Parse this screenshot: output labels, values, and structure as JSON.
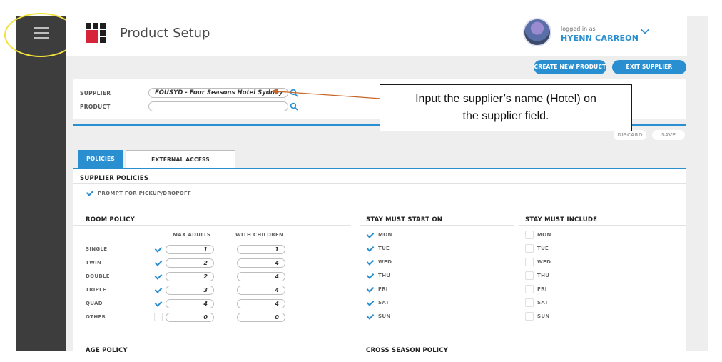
{
  "app": {
    "title": "Product Setup"
  },
  "user": {
    "logged_label": "logged in as",
    "name": "HYENN CARREON"
  },
  "actions": {
    "create_new_product": "CREATE NEW PRODUCT",
    "exit_supplier": "EXIT SUPPLIER",
    "discard": "DISCARD",
    "save": "SAVE"
  },
  "form": {
    "supplier_label": "SUPPLIER",
    "supplier_value": "FOUSYD - Four Seasons Hotel Sydney",
    "product_label": "PRODUCT",
    "product_value": ""
  },
  "callout": {
    "line1": "Input the supplier’s name (Hotel) on",
    "line2": "the supplier field."
  },
  "tabs": [
    {
      "label": "POLICIES",
      "active": true
    },
    {
      "label": "EXTERNAL ACCESS",
      "active": false
    }
  ],
  "supplier_policies": {
    "title": "SUPPLIER POLICIES",
    "prompt_pickup": {
      "label": "PROMPT FOR PICKUP/DROPOFF",
      "checked": true
    }
  },
  "room_policy": {
    "title": "ROOM POLICY",
    "col_max_adults": "MAX ADULTS",
    "col_with_children": "WITH CHILDREN",
    "rows": [
      {
        "label": "SINGLE",
        "checked": true,
        "max_adults": "1",
        "with_children": "1"
      },
      {
        "label": "TWIN",
        "checked": true,
        "max_adults": "2",
        "with_children": "4"
      },
      {
        "label": "DOUBLE",
        "checked": true,
        "max_adults": "2",
        "with_children": "4"
      },
      {
        "label": "TRIPLE",
        "checked": true,
        "max_adults": "3",
        "with_children": "4"
      },
      {
        "label": "QUAD",
        "checked": true,
        "max_adults": "4",
        "with_children": "4"
      },
      {
        "label": "OTHER",
        "checked": false,
        "max_adults": "0",
        "with_children": "0"
      }
    ]
  },
  "stay_must_start_on": {
    "title": "STAY MUST START ON",
    "days": [
      {
        "label": "MON",
        "checked": true
      },
      {
        "label": "TUE",
        "checked": true
      },
      {
        "label": "WED",
        "checked": true
      },
      {
        "label": "THU",
        "checked": true
      },
      {
        "label": "FRI",
        "checked": true
      },
      {
        "label": "SAT",
        "checked": true
      },
      {
        "label": "SUN",
        "checked": true
      }
    ]
  },
  "stay_must_include": {
    "title": "STAY MUST INCLUDE",
    "days": [
      {
        "label": "MON",
        "checked": false
      },
      {
        "label": "TUE",
        "checked": false
      },
      {
        "label": "WED",
        "checked": false
      },
      {
        "label": "THU",
        "checked": false
      },
      {
        "label": "FRI",
        "checked": false
      },
      {
        "label": "SAT",
        "checked": false
      },
      {
        "label": "SUN",
        "checked": false
      }
    ]
  },
  "sections_below": {
    "age_policy": "AGE POLICY",
    "cross_season_policy": "CROSS SEASON POLICY"
  },
  "colors": {
    "accent": "#2a8fd0",
    "sidebar": "#3d3d3d",
    "highlight": "#f3e23a",
    "arrow": "#c8662a"
  }
}
